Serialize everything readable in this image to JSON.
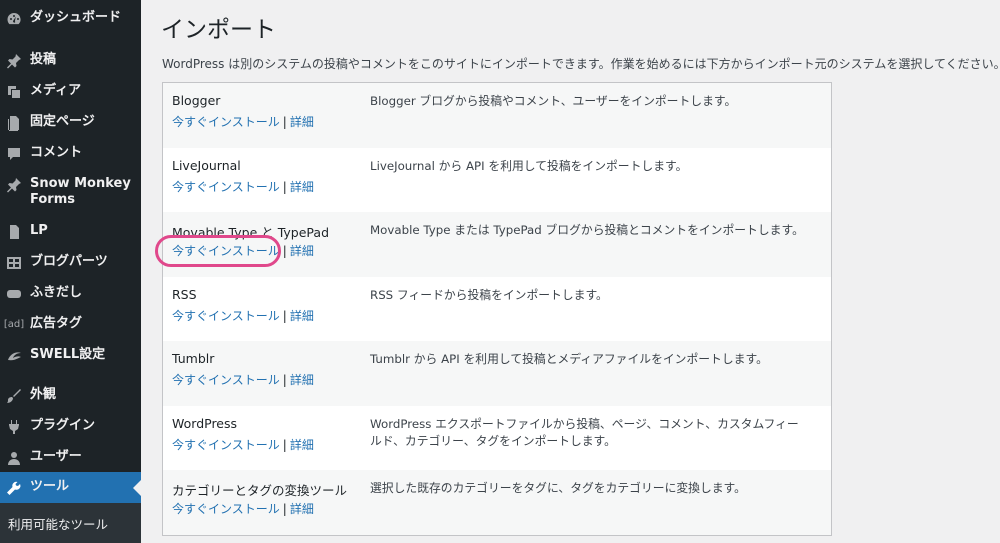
{
  "sidebar": {
    "items": [
      {
        "label": "ダッシュボード",
        "icon": "dashboard-icon"
      },
      {
        "label": "投稿",
        "icon": "pin-icon"
      },
      {
        "label": "メディア",
        "icon": "media-icon"
      },
      {
        "label": "固定ページ",
        "icon": "page-icon"
      },
      {
        "label": "コメント",
        "icon": "comment-icon"
      },
      {
        "label": "Snow Monkey Forms",
        "icon": "pin-icon"
      },
      {
        "label": "LP",
        "icon": "page-icon"
      },
      {
        "label": "ブログパーツ",
        "icon": "grid-icon"
      },
      {
        "label": "ふきだし",
        "icon": "speech-bubble-icon"
      },
      {
        "label": "広告タグ",
        "icon": "ad-icon"
      },
      {
        "label": "SWELL設定",
        "icon": "swell-icon"
      },
      {
        "label": "外観",
        "icon": "brush-icon"
      },
      {
        "label": "プラグイン",
        "icon": "plugin-icon"
      },
      {
        "label": "ユーザー",
        "icon": "user-icon"
      },
      {
        "label": "ツール",
        "icon": "wrench-icon"
      }
    ],
    "ad_icon_text": "[ad]",
    "submenu": {
      "item": "利用可能なツール"
    }
  },
  "page": {
    "title": "インポート",
    "intro": "WordPress は別のシステムの投稿やコメントをこのサイトにインポートできます。作業を始めるには下方からインポート元のシステムを選択してください。"
  },
  "importers": [
    {
      "name": "Blogger",
      "install": "今すぐインストール",
      "sep": "|",
      "details": "詳細",
      "desc": "Blogger ブログから投稿やコメント、ユーザーをインポートします。"
    },
    {
      "name": "LiveJournal",
      "install": "今すぐインストール",
      "sep": "|",
      "details": "詳細",
      "desc": "LiveJournal から API を利用して投稿をインポートします。"
    },
    {
      "name": "Movable Type と TypePad",
      "install": "今すぐインストール",
      "sep": "|",
      "details": "詳細",
      "desc": "Movable Type または TypePad ブログから投稿とコメントをインポートします。"
    },
    {
      "name": "RSS",
      "install": "今すぐインストール",
      "sep": "|",
      "details": "詳細",
      "desc": "RSS フィードから投稿をインポートします。"
    },
    {
      "name": "Tumblr",
      "install": "今すぐインストール",
      "sep": "|",
      "details": "詳細",
      "desc": "Tumblr から API を利用して投稿とメディアファイルをインポートします。"
    },
    {
      "name": "WordPress",
      "install": "今すぐインストール",
      "sep": "|",
      "details": "詳細",
      "desc": "WordPress エクスポートファイルから投稿、ページ、コメント、カスタムフィールド、カテゴリー、タグをインポートします。"
    },
    {
      "name": "カテゴリーとタグの変換ツール",
      "install": "今すぐインストール",
      "sep": "|",
      "details": "詳細",
      "desc": "選択した既存のカテゴリーをタグに、タグをカテゴリーに変換します。"
    }
  ],
  "colors": {
    "accent": "#2271b1",
    "sidebar": "#1d2327",
    "highlight": "#e0488b"
  }
}
